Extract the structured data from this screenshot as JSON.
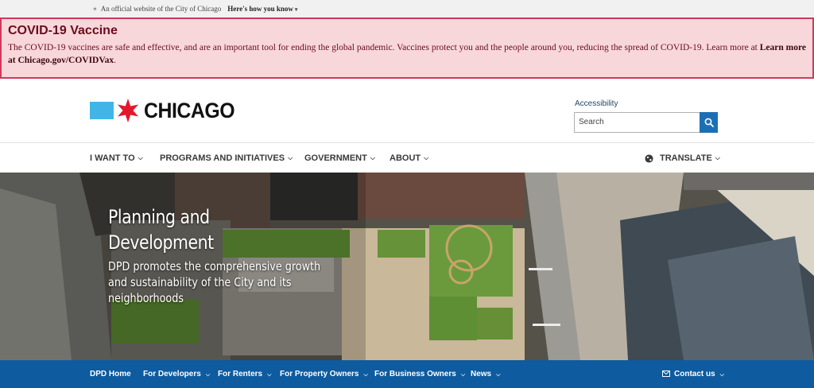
{
  "official_banner": {
    "text": "An official website of the City of Chicago",
    "link": "Here's how you know"
  },
  "alert": {
    "title": "COVID-19 Vaccine",
    "body": "The COVID-19 vaccines are safe and effective, and are an important tool for ending the global pandemic. Vaccines protect you and the people around you, reducing the spread of COVID-19. Learn more at",
    "link": "Learn more at Chicago.gov/COVIDVax",
    "end": "."
  },
  "header": {
    "logo_text": "CHICAGO",
    "accessibility_label": "Accessibility",
    "search_placeholder": "Search"
  },
  "main_nav": {
    "items": [
      {
        "label": "I WANT TO"
      },
      {
        "label": "PROGRAMS AND INITIATIVES"
      },
      {
        "label": "GOVERNMENT"
      },
      {
        "label": "ABOUT"
      }
    ],
    "translate": "TRANSLATE"
  },
  "hero": {
    "title": "Planning and Development",
    "subtitle": "DPD promotes the comprehensive growth and sustainability of the City and its neighborhoods"
  },
  "sub_nav": {
    "items": [
      {
        "label": "DPD Home"
      },
      {
        "label": "For Developers"
      },
      {
        "label": "For Renters"
      },
      {
        "label": "For Property Owners"
      },
      {
        "label": "For Business Owners"
      },
      {
        "label": "News"
      }
    ],
    "contact": "Contact us"
  },
  "colors": {
    "alert_bg": "#f8d7da",
    "alert_border": "#d0395b",
    "subnav_bg": "#0e5b9f",
    "flag_blue": "#41b6e6",
    "star_red": "#e4172b",
    "search_button": "#1d6fb3"
  },
  "icons": {
    "official": "star-icon",
    "search": "search-icon",
    "translate": "globe-icon",
    "contact": "mail-icon",
    "dropdown": "chevron-down-icon"
  }
}
